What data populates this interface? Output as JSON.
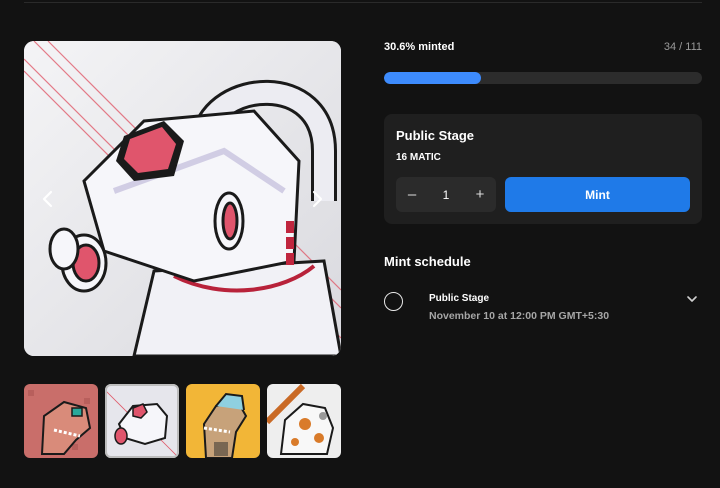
{
  "mint": {
    "percent_label": "30.6% minted",
    "count_label": "34 / 111",
    "progress_fraction": 0.306
  },
  "stage": {
    "title": "Public Stage",
    "price": "16 MATIC",
    "quantity": "1",
    "minus_label": "–",
    "plus_label": "+",
    "mint_label": "Mint"
  },
  "schedule": {
    "heading": "Mint schedule",
    "items": [
      {
        "title": "Public Stage",
        "date": "November 10 at 12:00 PM GMT+5:30"
      }
    ]
  },
  "gallery": {
    "prev_icon": "chevron-left-icon",
    "next_icon": "chevron-right-icon",
    "selected_thumb": 1,
    "thumb_colors": [
      "#c96e6a",
      "#e6e6ec",
      "#f2b637",
      "#eeeeee"
    ]
  },
  "colors": {
    "accent": "#1f7ae8",
    "progress": "#3d8bfd",
    "card": "#1f1f1f",
    "background": "#121212"
  }
}
